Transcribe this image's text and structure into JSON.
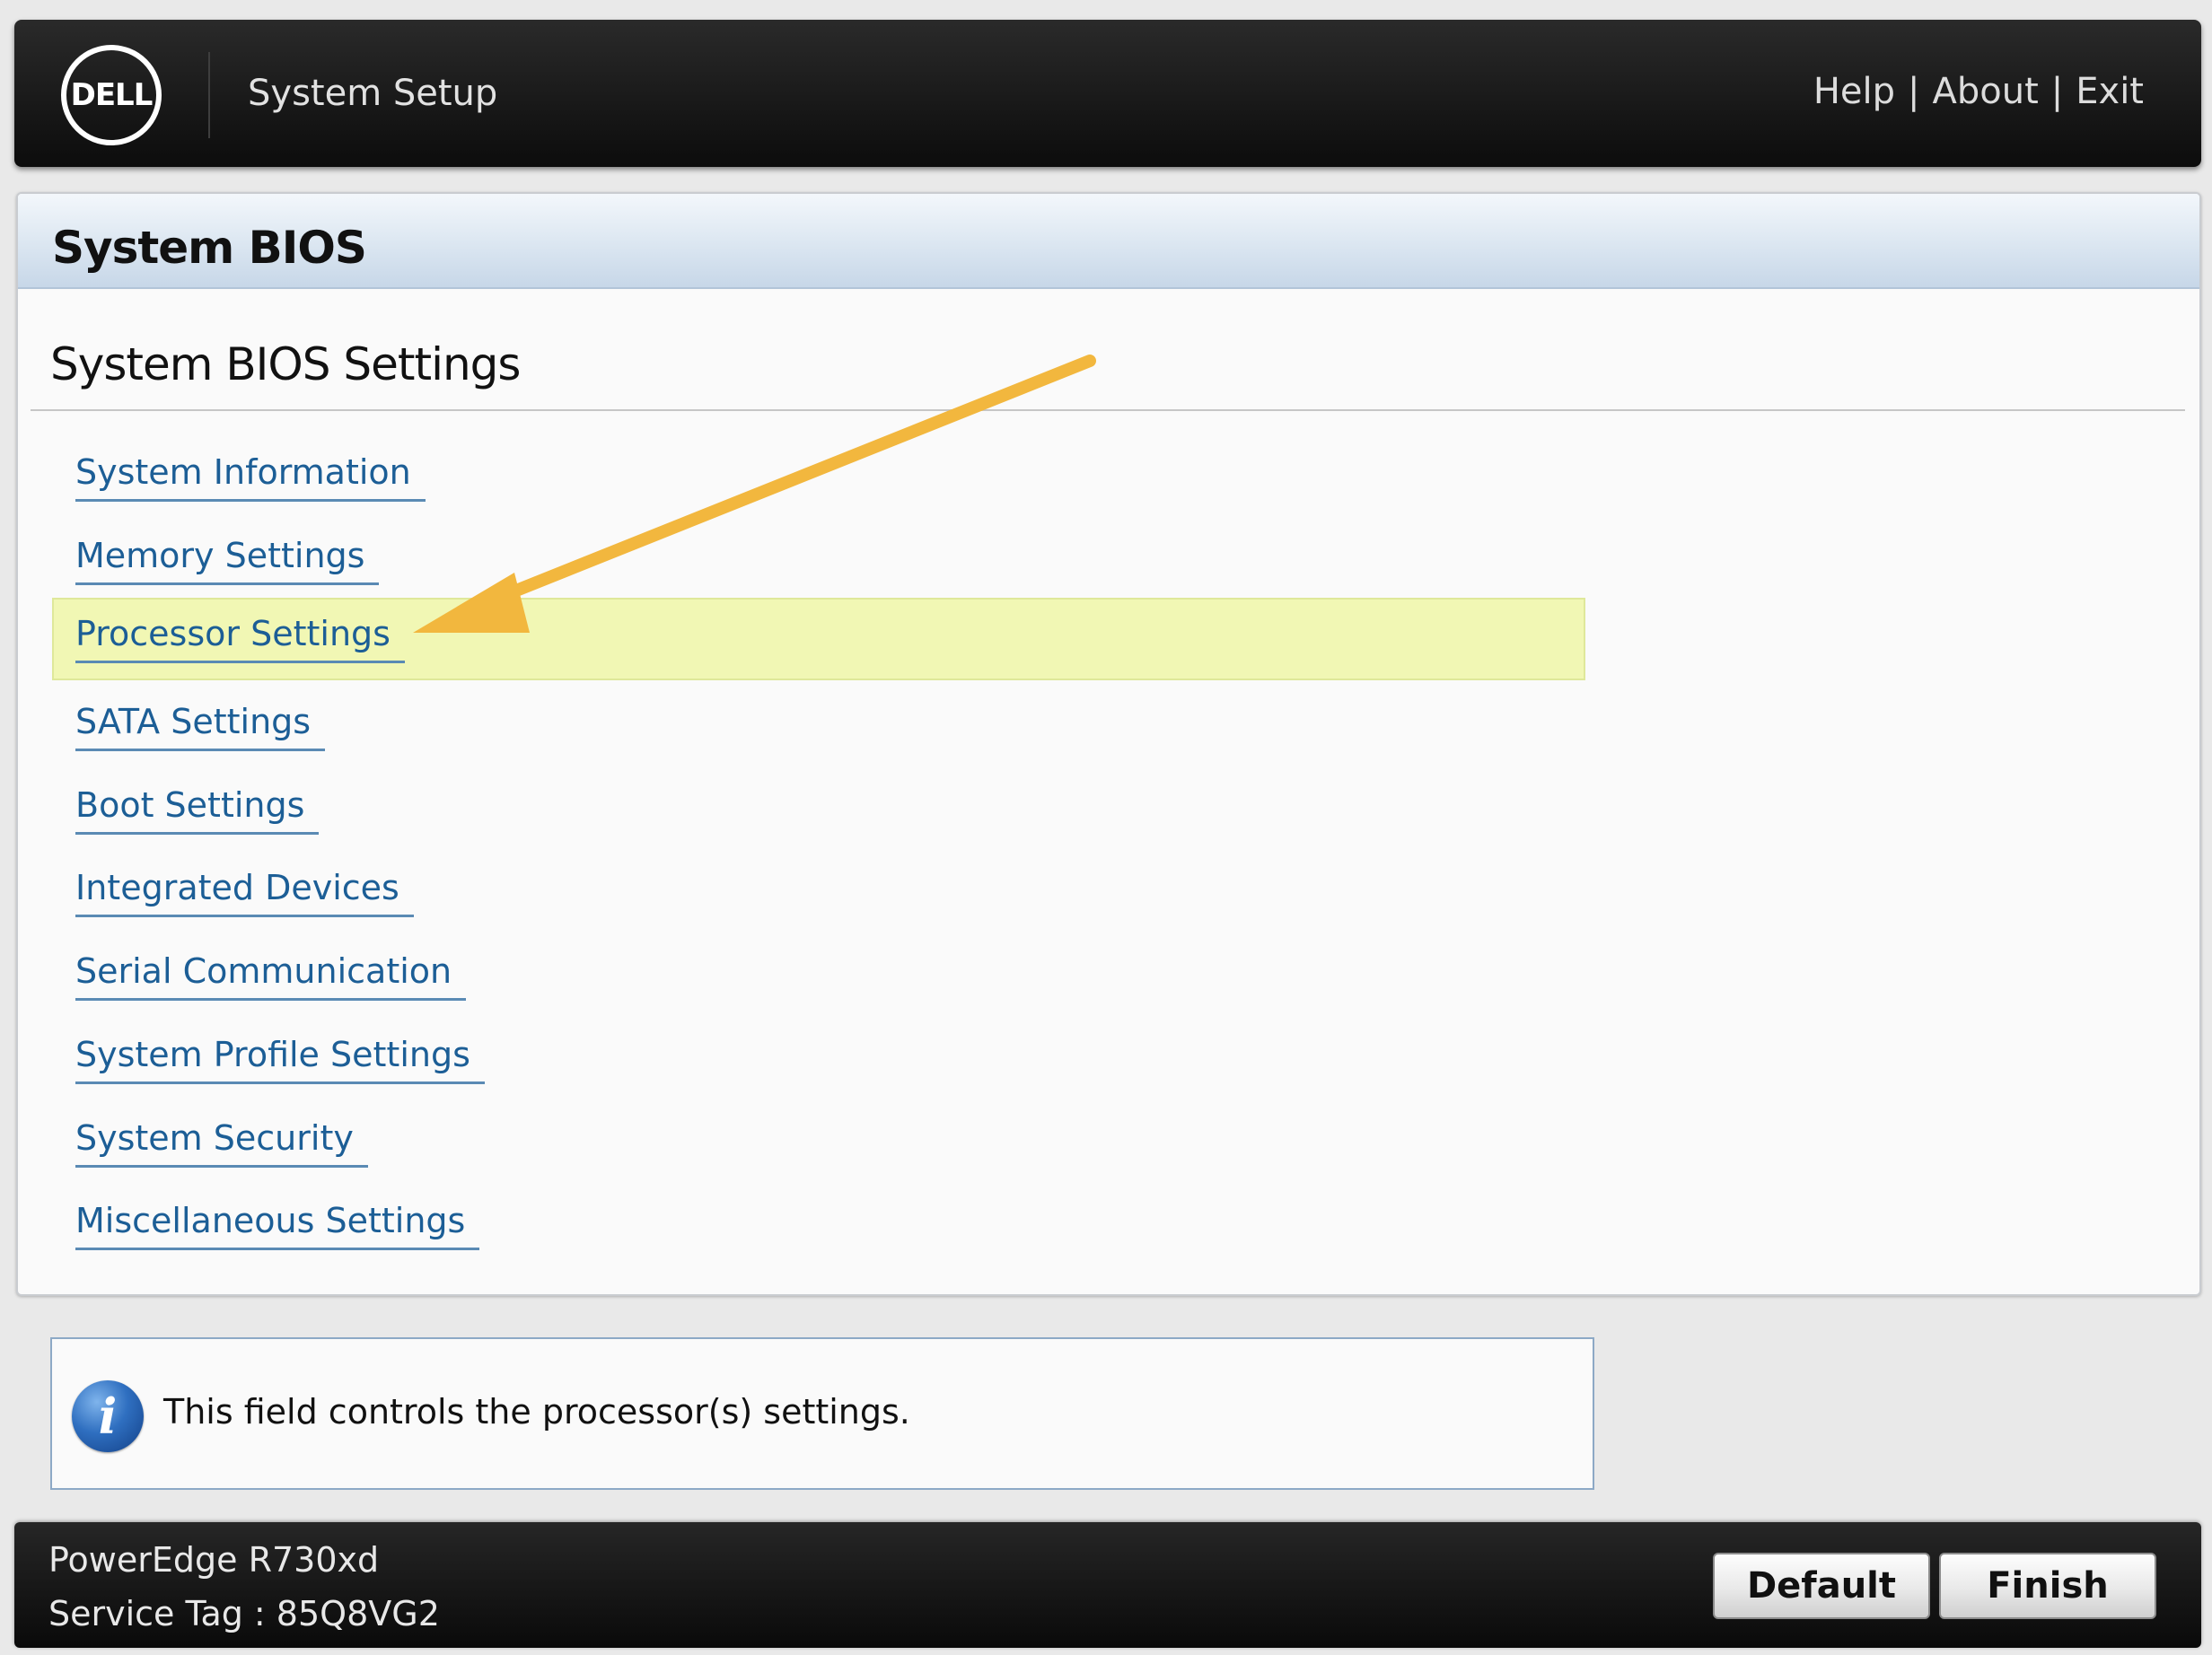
{
  "header": {
    "logo_text": "DELL",
    "app_title": "System Setup",
    "links": [
      {
        "label": "Help"
      },
      {
        "label": "About"
      },
      {
        "label": "Exit"
      }
    ],
    "link_separator": "|"
  },
  "panel": {
    "title": "System BIOS",
    "section_title": "System BIOS Settings",
    "menu_items": [
      {
        "label": "System Information"
      },
      {
        "label": "Memory Settings"
      },
      {
        "label": "Processor Settings",
        "selected": true
      },
      {
        "label": "SATA Settings"
      },
      {
        "label": "Boot Settings"
      },
      {
        "label": "Integrated Devices"
      },
      {
        "label": "Serial Communication"
      },
      {
        "label": "System Profile Settings"
      },
      {
        "label": "System Security"
      },
      {
        "label": "Miscellaneous Settings"
      }
    ]
  },
  "help": {
    "icon": "info-icon",
    "text": "This field controls the processor(s) settings."
  },
  "footer": {
    "model": "PowerEdge R730xd",
    "service_tag": "Service Tag : 85Q8VG2",
    "buttons": {
      "default_label": "Default",
      "finish_label": "Finish"
    }
  },
  "colors": {
    "header_bg": "#111111",
    "link_color": "#1c5e96",
    "selected_row": "#f1f7b4",
    "annotation_arrow": "#f2b73e"
  }
}
